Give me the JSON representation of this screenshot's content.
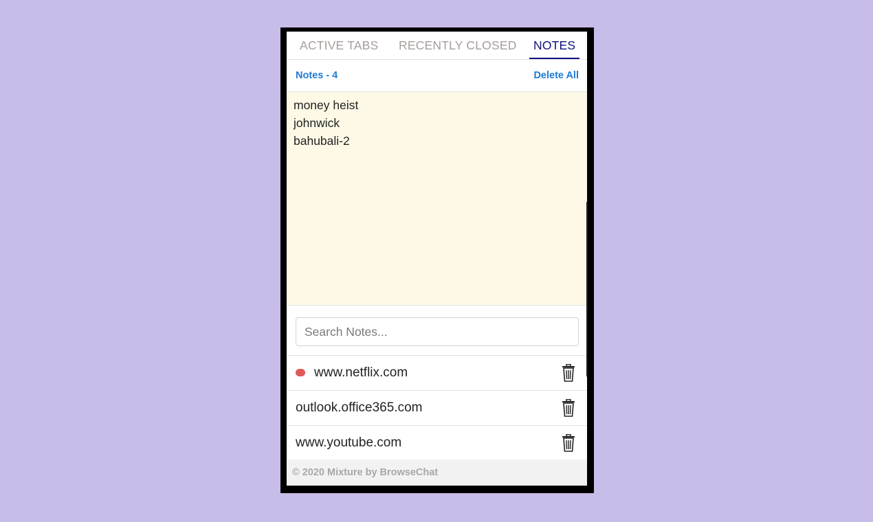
{
  "tabs": [
    {
      "label": "ACTIVE TABS",
      "active": false
    },
    {
      "label": "RECENTLY CLOSED",
      "active": false
    },
    {
      "label": "NOTES",
      "active": true
    }
  ],
  "notes_header": {
    "count_label": "Notes - 4",
    "delete_all_label": "Delete All"
  },
  "notes": {
    "lines": [
      "money heist",
      "johnwick",
      "bahubali-2"
    ]
  },
  "search": {
    "placeholder": "Search Notes...",
    "value": ""
  },
  "list": {
    "items": [
      {
        "label": "www.netflix.com",
        "has_dot": true,
        "icon": "trash-icon"
      },
      {
        "label": "outlook.office365.com",
        "has_dot": false,
        "icon": "trash-icon"
      },
      {
        "label": "www.youtube.com",
        "has_dot": false,
        "icon": "trash-icon"
      }
    ]
  },
  "footer": {
    "text": "© 2020 Mixture by BrowseChat"
  },
  "colors": {
    "background": "#c8bde8",
    "accent": "#1e7ad6",
    "active_tab": "#0d0f7d",
    "notes_bg": "#fef9e6",
    "dot": "#e05a5a"
  }
}
